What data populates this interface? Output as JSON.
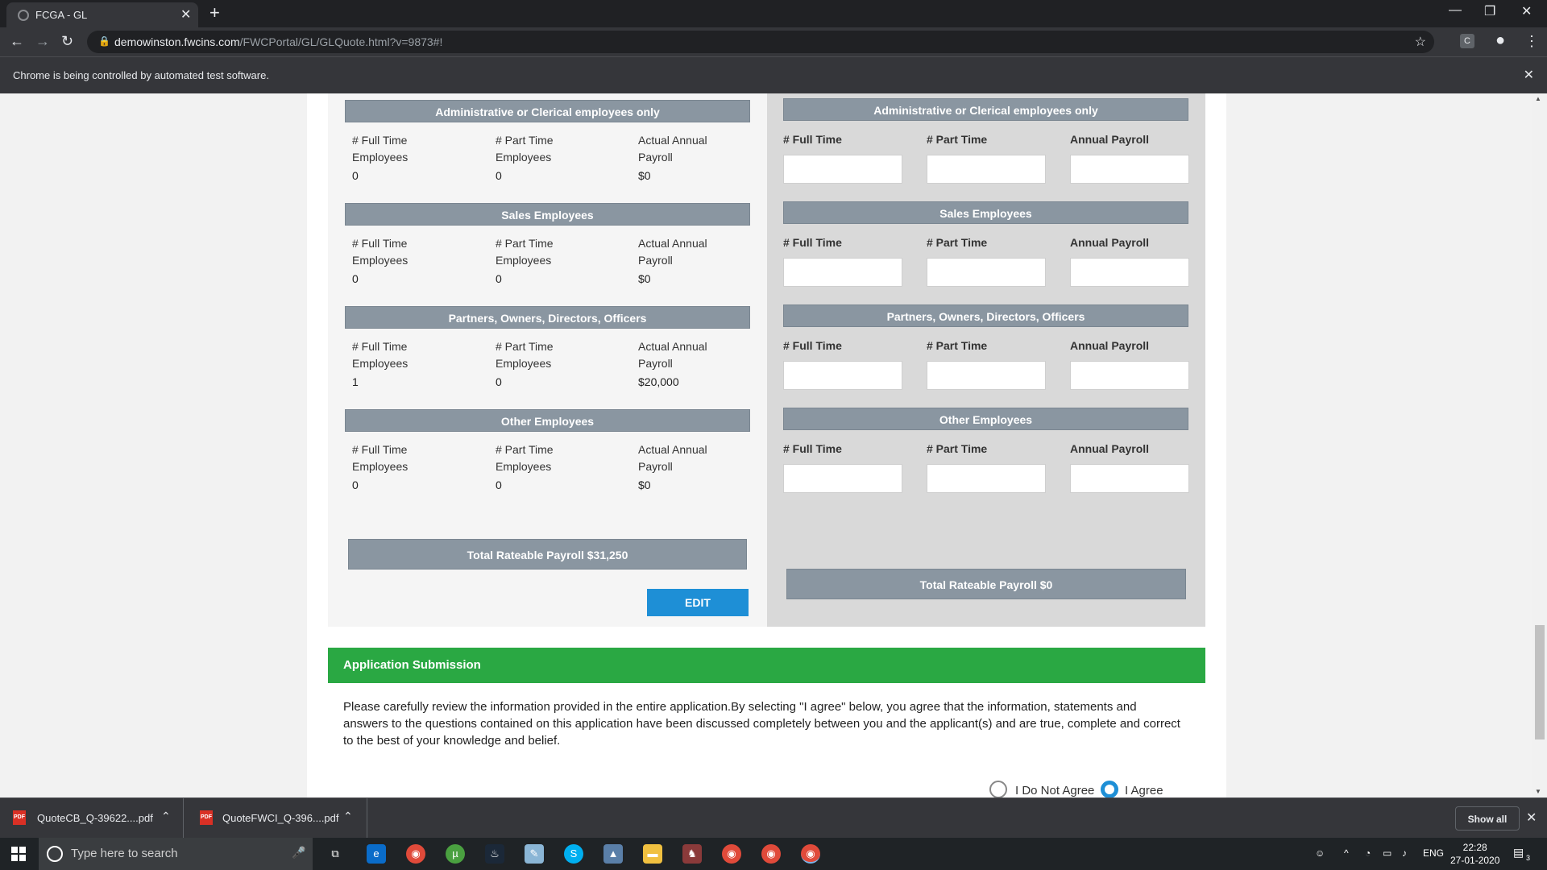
{
  "browser": {
    "tab_title": "FCGA - GL",
    "url_host": "demowinston.fwcins.com",
    "url_path": "/FWCPortal/GL/GLQuote.html?v=9873#!",
    "infobar_message": "Chrome is being controlled by automated test software."
  },
  "left": {
    "sections": [
      {
        "title": "Administrative or Clerical employees only",
        "ft_label_1": "# Full Time",
        "ft_label_2": "Employees",
        "pt_label_1": "# Part Time",
        "pt_label_2": "Employees",
        "pay_label_1": "Actual Annual",
        "pay_label_2": "Payroll",
        "ft": "0",
        "pt": "0",
        "payroll": "$0"
      },
      {
        "title": "Sales Employees",
        "ft_label_1": "# Full Time",
        "ft_label_2": "Employees",
        "pt_label_1": "# Part Time",
        "pt_label_2": "Employees",
        "pay_label_1": "Actual Annual",
        "pay_label_2": "Payroll",
        "ft": "0",
        "pt": "0",
        "payroll": "$0"
      },
      {
        "title": "Partners, Owners, Directors, Officers",
        "ft_label_1": "# Full Time",
        "ft_label_2": "Employees",
        "pt_label_1": "# Part Time",
        "pt_label_2": "Employees",
        "pay_label_1": "Actual Annual",
        "pay_label_2": "Payroll",
        "ft": "1",
        "pt": "0",
        "payroll": "$20,000"
      },
      {
        "title": "Other Employees",
        "ft_label_1": "# Full Time",
        "ft_label_2": "Employees",
        "pt_label_1": "# Part Time",
        "pt_label_2": "Employees",
        "pay_label_1": "Actual Annual",
        "pay_label_2": "Payroll",
        "ft": "0",
        "pt": "0",
        "payroll": "$0"
      }
    ],
    "total": "Total Rateable Payroll  $31,250",
    "edit_label": "EDIT"
  },
  "right": {
    "sections": [
      {
        "title": "Administrative or Clerical employees only",
        "ft_label": "# Full Time",
        "pt_label": "# Part Time",
        "pay_label": "Annual Payroll",
        "ft": "",
        "pt": "",
        "payroll": ""
      },
      {
        "title": "Sales Employees",
        "ft_label": "# Full Time",
        "pt_label": "# Part Time",
        "pay_label": "Annual Payroll",
        "ft": "",
        "pt": "",
        "payroll": ""
      },
      {
        "title": "Partners, Owners, Directors, Officers",
        "ft_label": "# Full Time",
        "pt_label": "# Part Time",
        "pay_label": "Annual Payroll",
        "ft": "",
        "pt": "",
        "payroll": ""
      },
      {
        "title": "Other Employees",
        "ft_label": "# Full Time",
        "pt_label": "# Part Time",
        "pay_label": "Annual Payroll",
        "ft": "",
        "pt": "",
        "payroll": ""
      }
    ],
    "total": "Total Rateable Payroll  $0"
  },
  "submission": {
    "title": "Application Submission",
    "text": "Please carefully review the information provided in the entire application.By selecting \"I agree\" below, you agree that the information, statements and answers to the questions contained on this application have been discussed completely between you and the applicant(s) and are true, complete and correct to the best of your knowledge and belief.",
    "options": [
      {
        "label": "I Do Not Agree",
        "selected": false
      },
      {
        "label": "I Agree",
        "selected": true
      }
    ]
  },
  "downloads": {
    "items": [
      "QuoteCB_Q-39622....pdf",
      "QuoteFWCI_Q-396....pdf"
    ],
    "show_all": "Show all"
  },
  "taskbar": {
    "search_placeholder": "Type here to search",
    "language": "ENG",
    "time": "22:28",
    "date": "27-01-2020",
    "notifications": "3"
  },
  "colors": {
    "section_header": "#8a96a1",
    "submission_bar": "#2aa843",
    "edit_button": "#1e8fd6"
  }
}
